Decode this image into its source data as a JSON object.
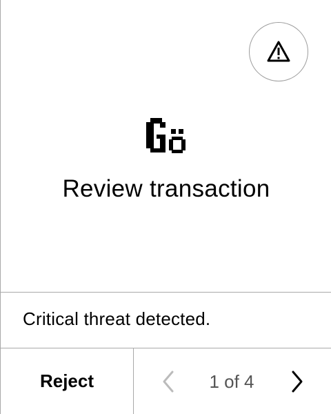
{
  "screen": {
    "title": "Review transaction",
    "alert_message": "Critical threat detected.",
    "warning_icon": "warning-triangle-icon",
    "app_logo_icon": "app-logo-icon"
  },
  "footer": {
    "reject_label": "Reject",
    "pager": {
      "label": "1 of 4",
      "current_page": 1,
      "total_pages": 4,
      "prev_icon": "chevron-left-icon",
      "next_icon": "chevron-right-icon",
      "prev_enabled": false,
      "next_enabled": true
    }
  },
  "colors": {
    "background": "#ffffff",
    "text": "#000000",
    "divider": "#a8a8a8",
    "muted": "#555555",
    "disabled": "#bbbbbb"
  }
}
